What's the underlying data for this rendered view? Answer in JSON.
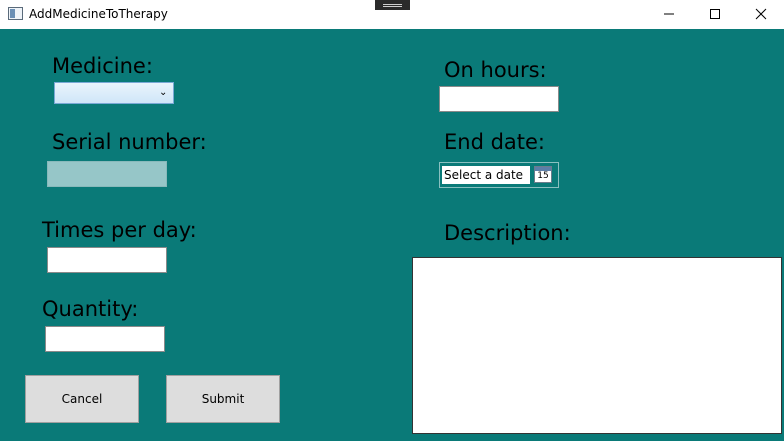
{
  "window": {
    "title": "AddMedicineToTherapy"
  },
  "form": {
    "medicine_label": "Medicine:",
    "medicine_selected": "",
    "serial_label": "Serial number:",
    "serial_value": "",
    "times_label": "Times per day:",
    "times_value": "",
    "quantity_label": "Quantity:",
    "quantity_value": "",
    "hours_label": "On hours:",
    "hours_value": "",
    "end_date_label": "End date:",
    "end_date_placeholder": "Select a date",
    "calendar_day": "15",
    "description_label": "Description:",
    "description_value": ""
  },
  "buttons": {
    "cancel": "Cancel",
    "submit": "Submit"
  },
  "colors": {
    "background": "#0a7a78",
    "button": "#dddddd"
  }
}
